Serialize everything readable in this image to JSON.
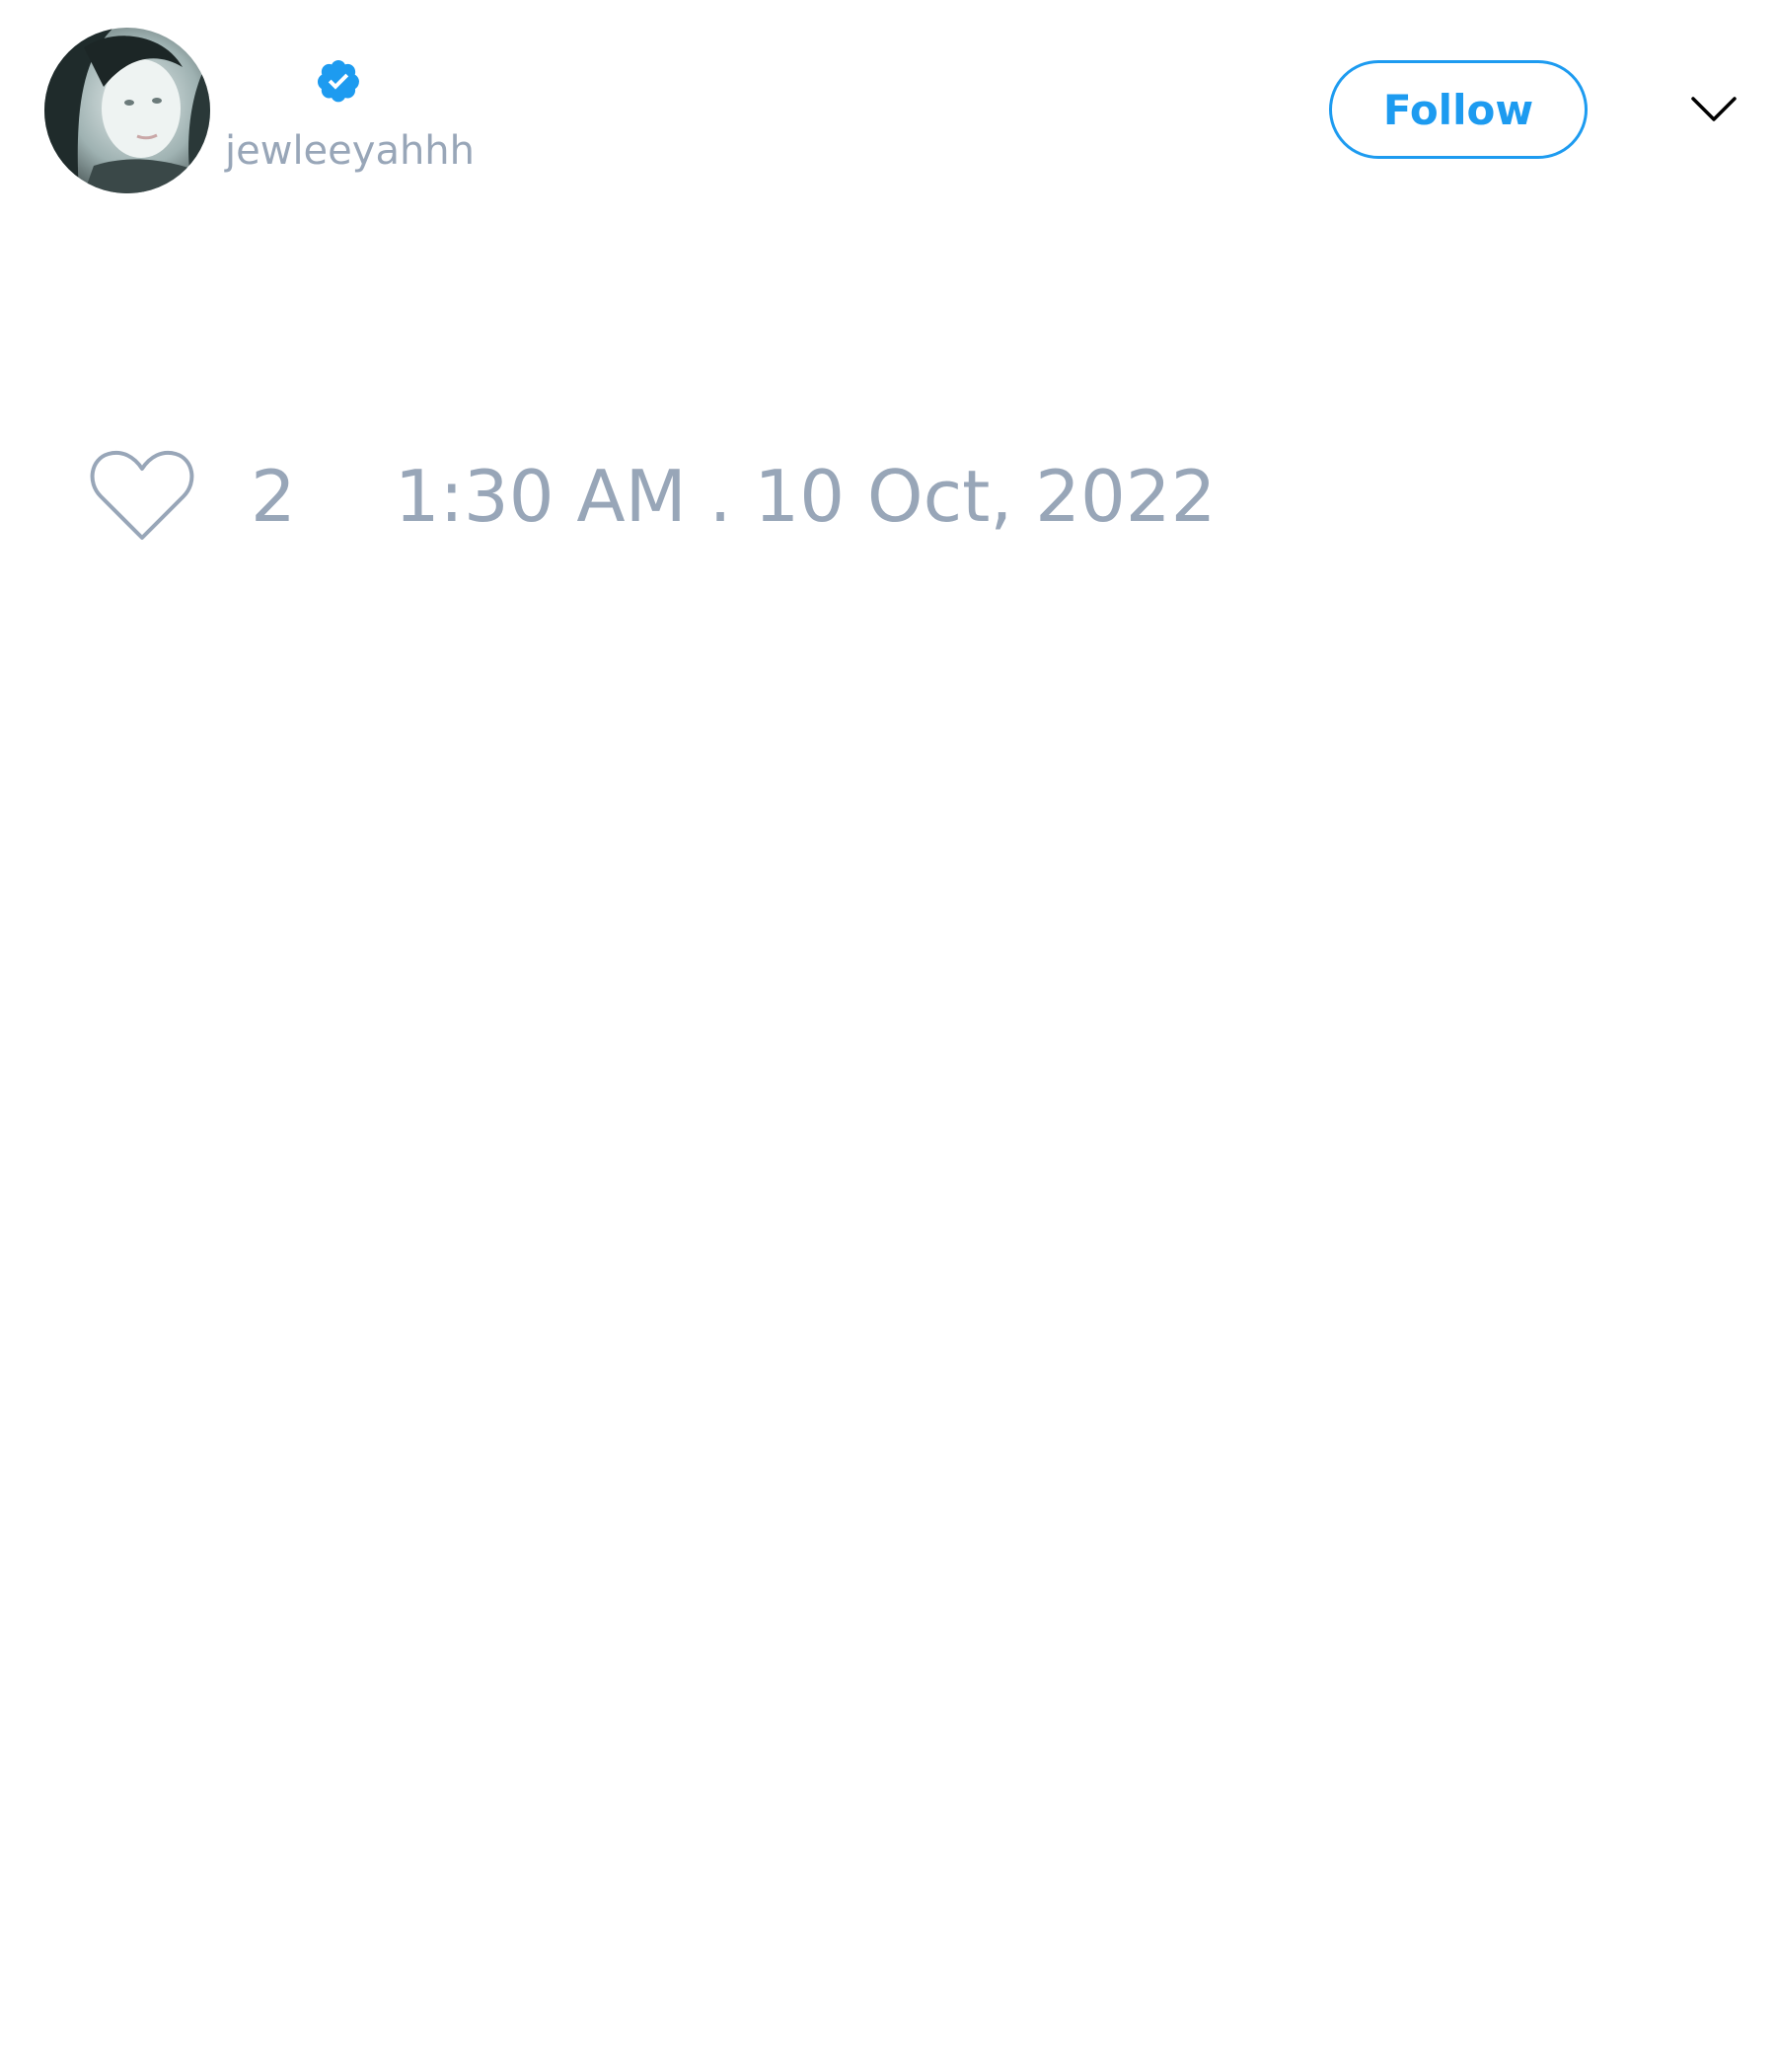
{
  "tweet": {
    "author": {
      "display_name": "",
      "handle": "jewleeyahhh",
      "verified": true,
      "avatar_icon": "profile-photo"
    },
    "follow_button": {
      "label": "Follow"
    },
    "menu_icon": "chevron-down-icon",
    "like": {
      "icon": "heart-outline-icon",
      "count": "2"
    },
    "timestamp": "1:30 AM . 10 Oct, 2022"
  },
  "colors": {
    "accent": "#1d9bf0",
    "muted_text": "#98a6b8",
    "background": "#ffffff"
  }
}
